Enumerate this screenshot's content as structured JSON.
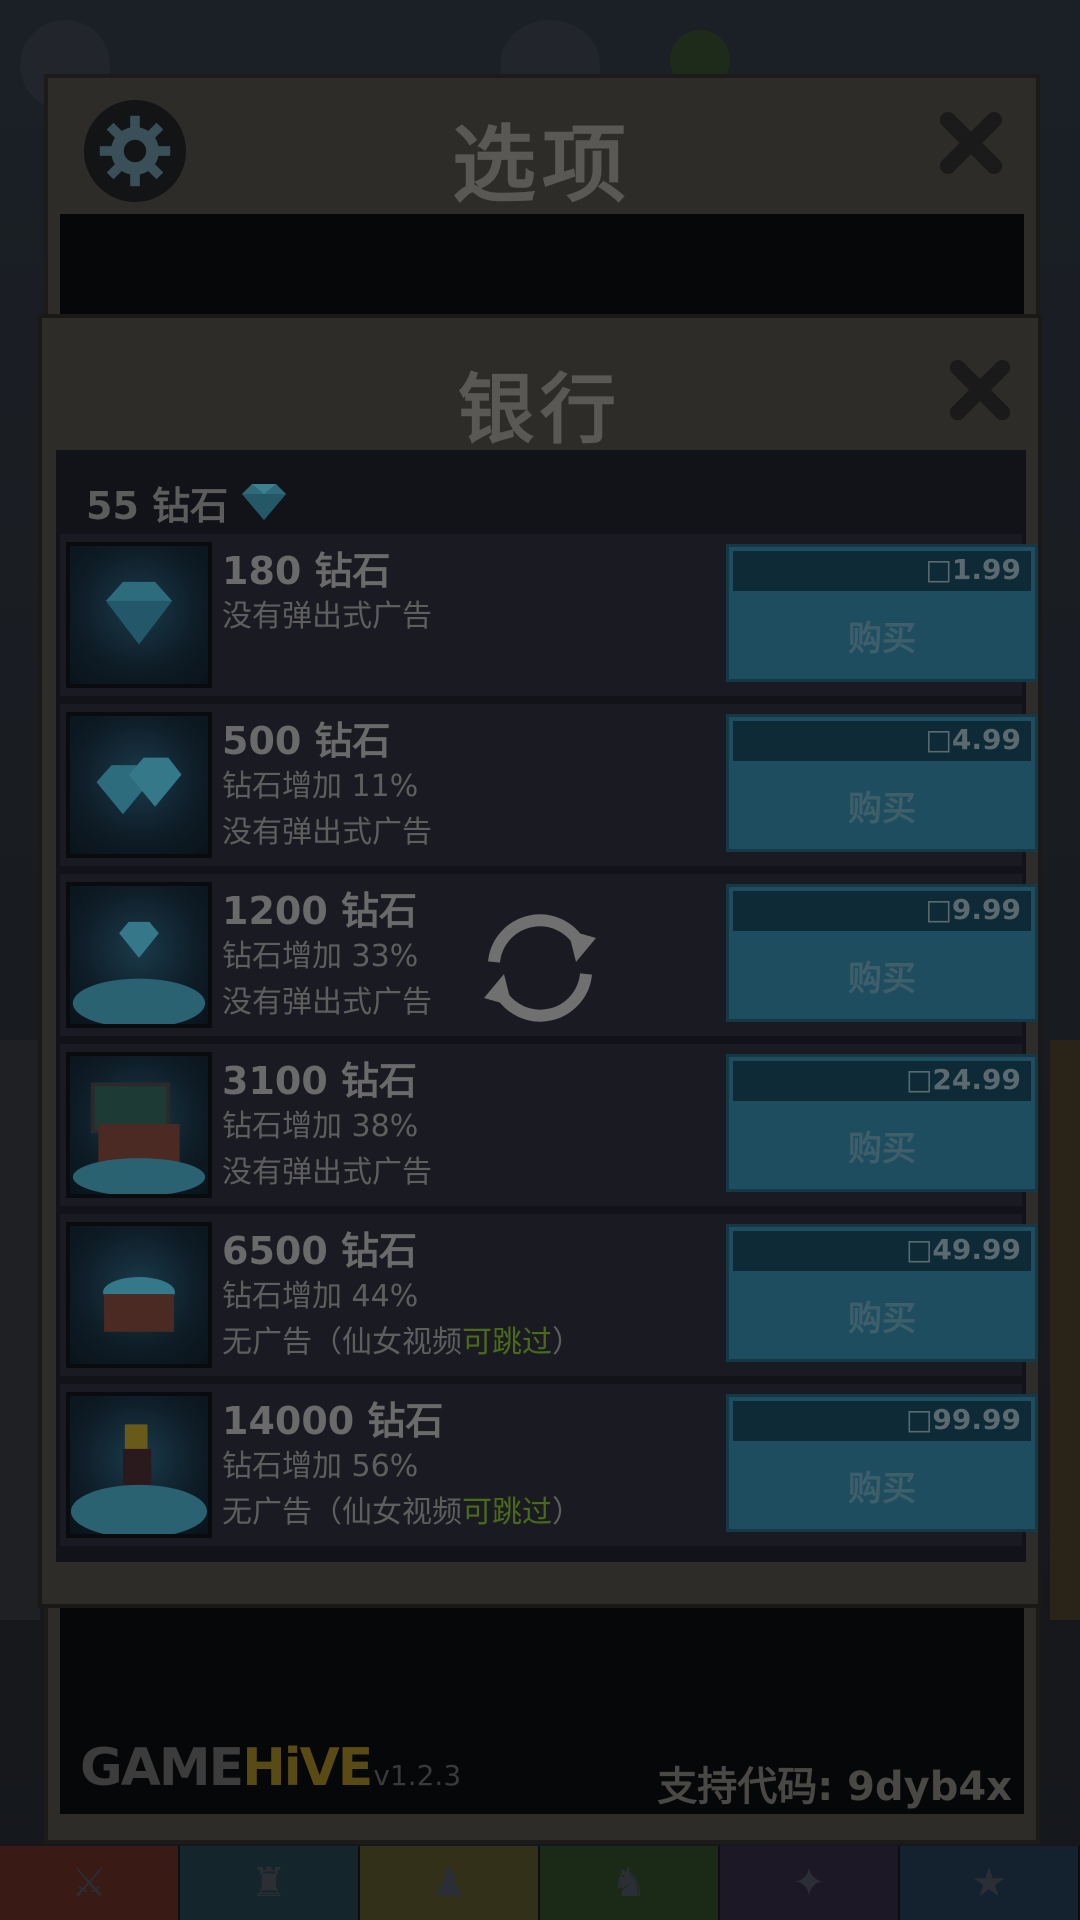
{
  "options": {
    "title": "选项",
    "gamehive_game": "GAME",
    "gamehive_hive": "HiVE",
    "version": "v1.2.3",
    "support_code": "支持代码: 9dyb4x"
  },
  "bank": {
    "title": "银行",
    "balance_text": "55 钻石"
  },
  "packs": [
    {
      "name": "180 钻石",
      "lines": [
        "没有弹出式广告"
      ],
      "price": "□1.99",
      "buy_label": "购买",
      "green": ""
    },
    {
      "name": "500 钻石",
      "lines": [
        "钻石增加 11%",
        "没有弹出式广告"
      ],
      "price": "□4.99",
      "buy_label": "购买",
      "green": ""
    },
    {
      "name": "1200 钻石",
      "lines": [
        "钻石增加 33%",
        "没有弹出式广告"
      ],
      "price": "□9.99",
      "buy_label": "购买",
      "green": ""
    },
    {
      "name": "3100 钻石",
      "lines": [
        "钻石增加 38%",
        "没有弹出式广告"
      ],
      "price": "□24.99",
      "buy_label": "购买",
      "green": ""
    },
    {
      "name": "6500 钻石",
      "lines": [
        "钻石增加 44%",
        "无广告（仙女视频"
      ],
      "green": "可跳过",
      "tail": "）",
      "price": "□49.99",
      "buy_label": "购买"
    },
    {
      "name": "14000 钻石",
      "lines": [
        "钻石增加 56%",
        "无广告（仙女视频"
      ],
      "green": "可跳过",
      "tail": "）",
      "price": "□99.99",
      "buy_label": "购买"
    }
  ]
}
